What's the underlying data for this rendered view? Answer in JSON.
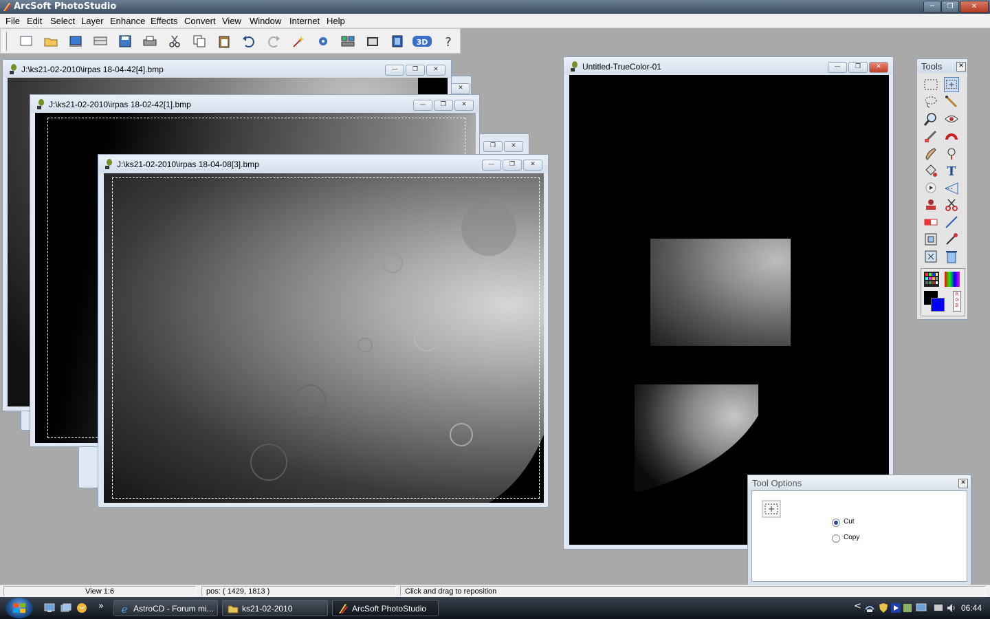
{
  "app": {
    "title": "ArcSoft PhotoStudio"
  },
  "menu": [
    "File",
    "Edit",
    "Select",
    "Layer",
    "Enhance",
    "Effects",
    "Convert",
    "View",
    "Window",
    "Internet",
    "Help"
  ],
  "toolbar": {
    "icons": [
      "new-file-icon",
      "open-folder-icon",
      "acquire-icon",
      "scan-icon",
      "save-icon",
      "print-icon",
      "cut-icon",
      "copy-icon",
      "paste-icon",
      "undo-icon",
      "redo-icon",
      "magic-wand-icon",
      "remove-red-eye-icon",
      "compare-icon",
      "slideshow-icon",
      "calendar-icon",
      "3d-icon",
      "help-icon"
    ]
  },
  "windows": {
    "doc1": {
      "title": "J:\\ks21-02-2010\\irpas 18-04-42[4].bmp"
    },
    "doc2": {
      "title": "J:\\ks21-02-2010\\irpas 18-02-42[1].bmp"
    },
    "doc3": {
      "title": "J:\\ks21-02-2010\\irpas 18-04-08[3].bmp"
    },
    "doc4": {
      "title": "Untitled-TrueColor-01"
    }
  },
  "tools_panel": {
    "title": "Tools",
    "tools": [
      "rect-select-icon",
      "move-select-icon",
      "lasso-icon",
      "wand-pen-icon",
      "zoom-icon",
      "red-eye-icon",
      "brush-icon",
      "magnet-icon",
      "smudge-icon",
      "clone-icon",
      "bucket-icon",
      "text-icon",
      "shape-icon",
      "gradient-icon",
      "stamp-icon",
      "scissors-icon",
      "eraser-icon",
      "line-icon",
      "transform-icon",
      "eyedropper-icon",
      "crop-icon",
      "trash-icon"
    ],
    "rgb_label": "RGB",
    "colors": {
      "foreground": "#000000",
      "background": "#0000ff"
    }
  },
  "tool_options": {
    "title": "Tool Options",
    "options": [
      {
        "label": "Cut",
        "selected": true
      },
      {
        "label": "Copy",
        "selected": false
      }
    ]
  },
  "status": {
    "view": "View 1:6",
    "pos": "pos: ( 1429, 1813 )",
    "hint": "Click and drag to reposition"
  },
  "taskbar": {
    "tasks": [
      {
        "label": "AstroCD - Forum mi...",
        "icon": "ie-icon"
      },
      {
        "label": "ks21-02-2010",
        "icon": "folder-icon"
      },
      {
        "label": "ArcSoft PhotoStudio",
        "icon": "photostudio-icon"
      }
    ],
    "quick_launch_chevron": "»",
    "tray_chevron": "<",
    "clock": "06:44"
  }
}
